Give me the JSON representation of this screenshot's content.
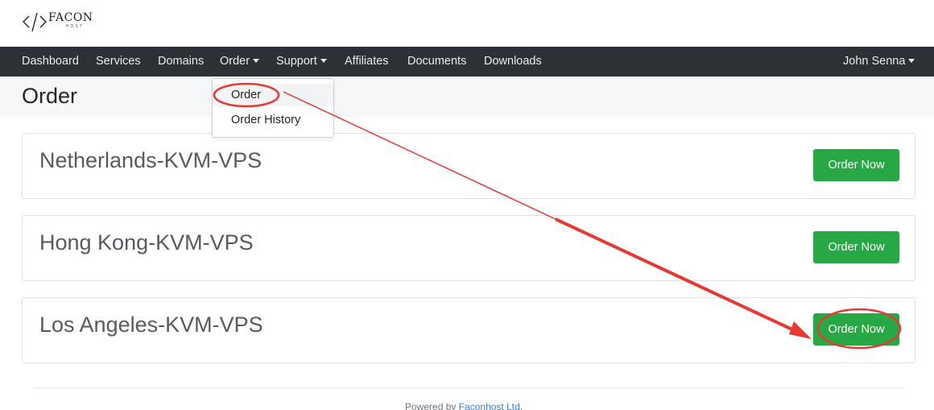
{
  "brand": {
    "name": "FACON",
    "tagline": "HOST"
  },
  "nav": {
    "items": [
      {
        "label": "Dashboard"
      },
      {
        "label": "Services"
      },
      {
        "label": "Domains"
      },
      {
        "label": "Order"
      },
      {
        "label": "Support"
      },
      {
        "label": "Affiliates"
      },
      {
        "label": "Documents"
      },
      {
        "label": "Downloads"
      }
    ],
    "user": "John Senna"
  },
  "order_menu": {
    "items": [
      {
        "label": "Order"
      },
      {
        "label": "Order History"
      }
    ]
  },
  "page": {
    "title": "Order"
  },
  "products": [
    {
      "name": "Netherlands-KVM-VPS",
      "button": "Order Now"
    },
    {
      "name": "Hong Kong-KVM-VPS",
      "button": "Order Now"
    },
    {
      "name": "Los Angeles-KVM-VPS",
      "button": "Order Now"
    }
  ],
  "footer": {
    "prefix": "Powered by",
    "link": "Faconhost Ltd."
  },
  "colors": {
    "navbar": "#2d3034",
    "success": "#28a745",
    "annotation": "#e53935"
  }
}
